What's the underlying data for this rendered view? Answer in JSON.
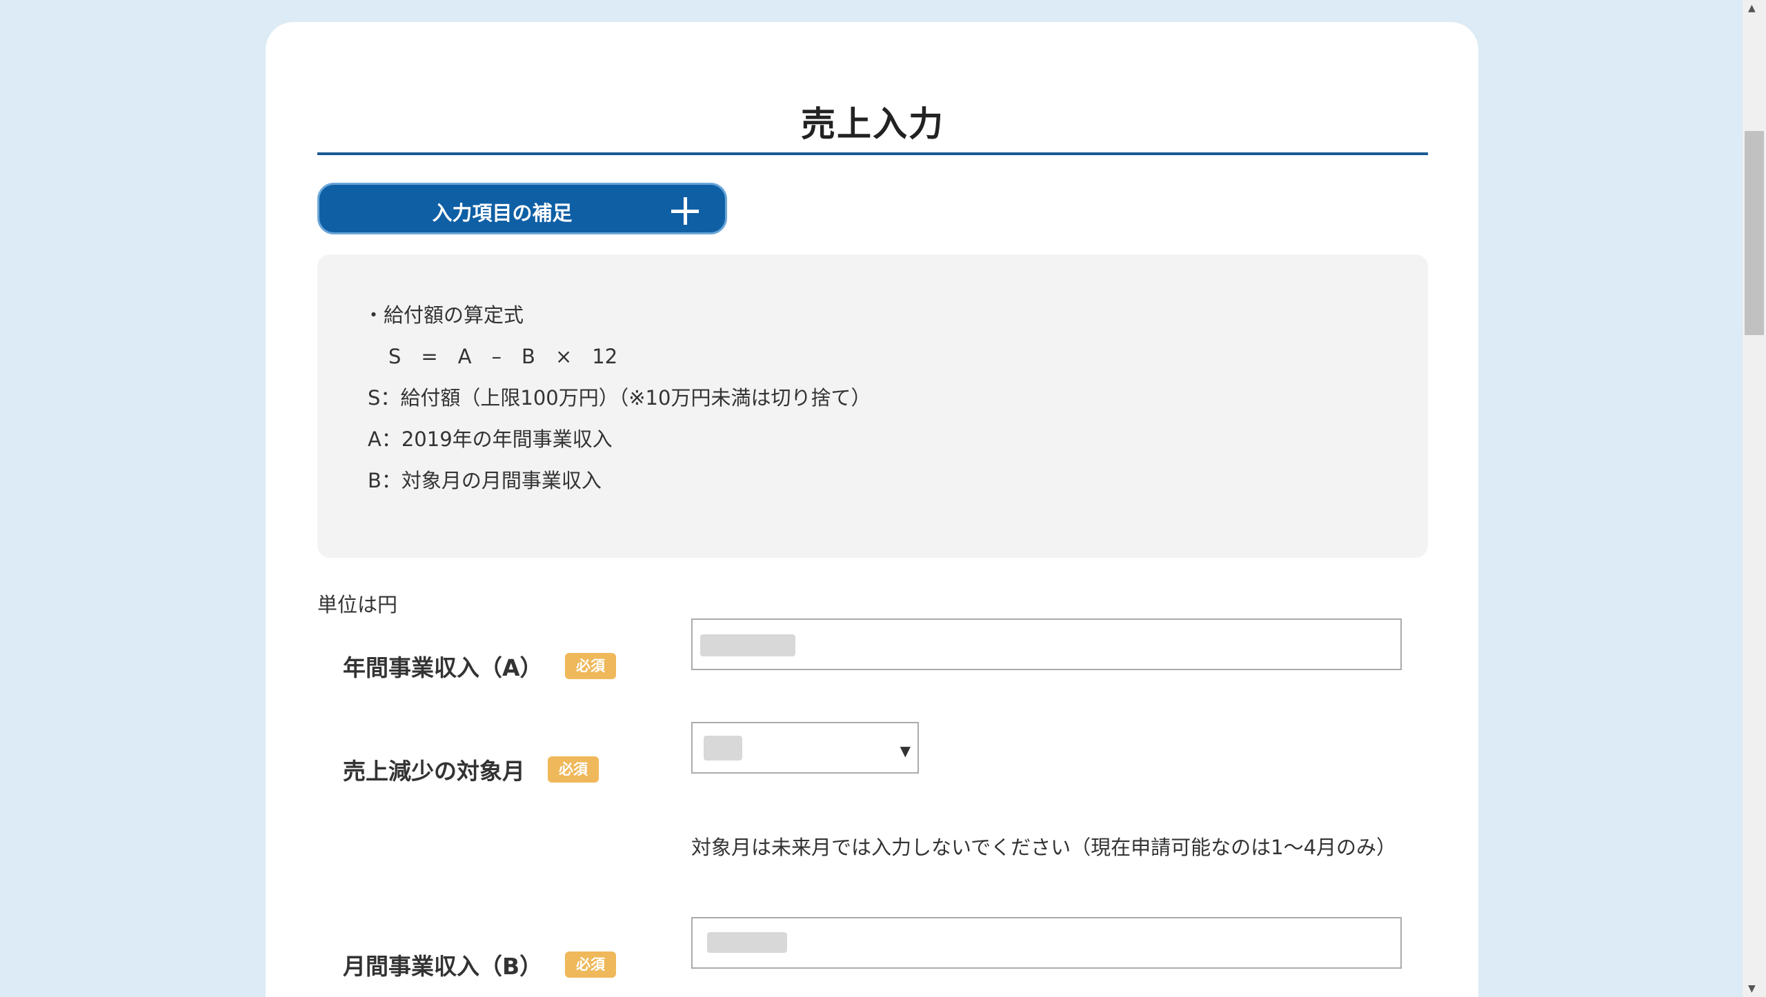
{
  "page": {
    "title": "売上入力"
  },
  "supplement": {
    "button_label": "入力項目の補足",
    "lines": [
      "・給付額の算定式",
      "S　=　A　–　B　×　12",
      "S：給付額（上限100万円）（※10万円未満は切り捨て）",
      "A：2019年の年間事業収入",
      "B：対象月の月間事業収入"
    ]
  },
  "form": {
    "unit_label": "単位は円",
    "required_badge": "必須",
    "annual_revenue": {
      "label": "年間事業収入（A）",
      "value": ""
    },
    "target_month": {
      "label": "売上減少の対象月",
      "selected": "",
      "helper": "対象月は未来月では入力しないでください（現在申請可能なのは1～4月のみ）"
    },
    "monthly_revenue": {
      "label": "月間事業収入（B）",
      "value": ""
    }
  },
  "colors": {
    "background": "#dcebf5",
    "primary_button": "#0f5fa5",
    "title_rule": "#1a5a91",
    "required_badge": "#efb85a",
    "notes_panel": "#f3f3f3"
  },
  "icons": {
    "toggle": "plus-icon",
    "select": "chevron-down-icon"
  }
}
